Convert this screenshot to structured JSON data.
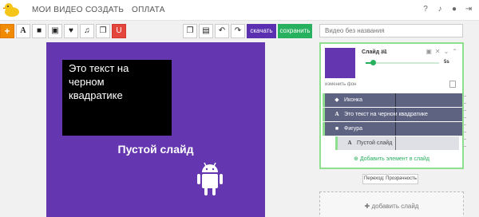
{
  "nav": {
    "items": [
      "МОИ ВИДЕО",
      "СОЗДАТЬ",
      "ОПЛАТА"
    ]
  },
  "toolbar": {
    "add_label": "+",
    "text_label": "A",
    "download_label": "скачать",
    "save_label": "сохранить"
  },
  "video_title": {
    "placeholder": "Видео без названия"
  },
  "slide": {
    "black_box_text": "Это текст на черном квадратике",
    "title": "Пустой слайд",
    "bg_color": "#6436b0"
  },
  "panel": {
    "slide_name": "Слайд #1",
    "duration": "5s",
    "duration_fraction": 0.1,
    "change_bg": "изменить фон",
    "layers": [
      {
        "icon": "star-icon",
        "glyph": "◆",
        "label": "Иконка"
      },
      {
        "icon": "text-icon",
        "glyph": "A",
        "label": "Это текст на черном квадратике"
      },
      {
        "icon": "square-icon",
        "glyph": "■",
        "label": "Фигура"
      },
      {
        "icon": "text-icon",
        "glyph": "A",
        "label": "Пустой слайд"
      }
    ],
    "add_element": "Добавить элемент в слайд"
  },
  "transition": {
    "label": "Переход: Прозрачность"
  },
  "add_slide": {
    "label": "добавить слайд"
  },
  "colors": {
    "accent_purple": "#5a2fb0",
    "save_green": "#27b05d",
    "add_orange": "#f08a00"
  }
}
